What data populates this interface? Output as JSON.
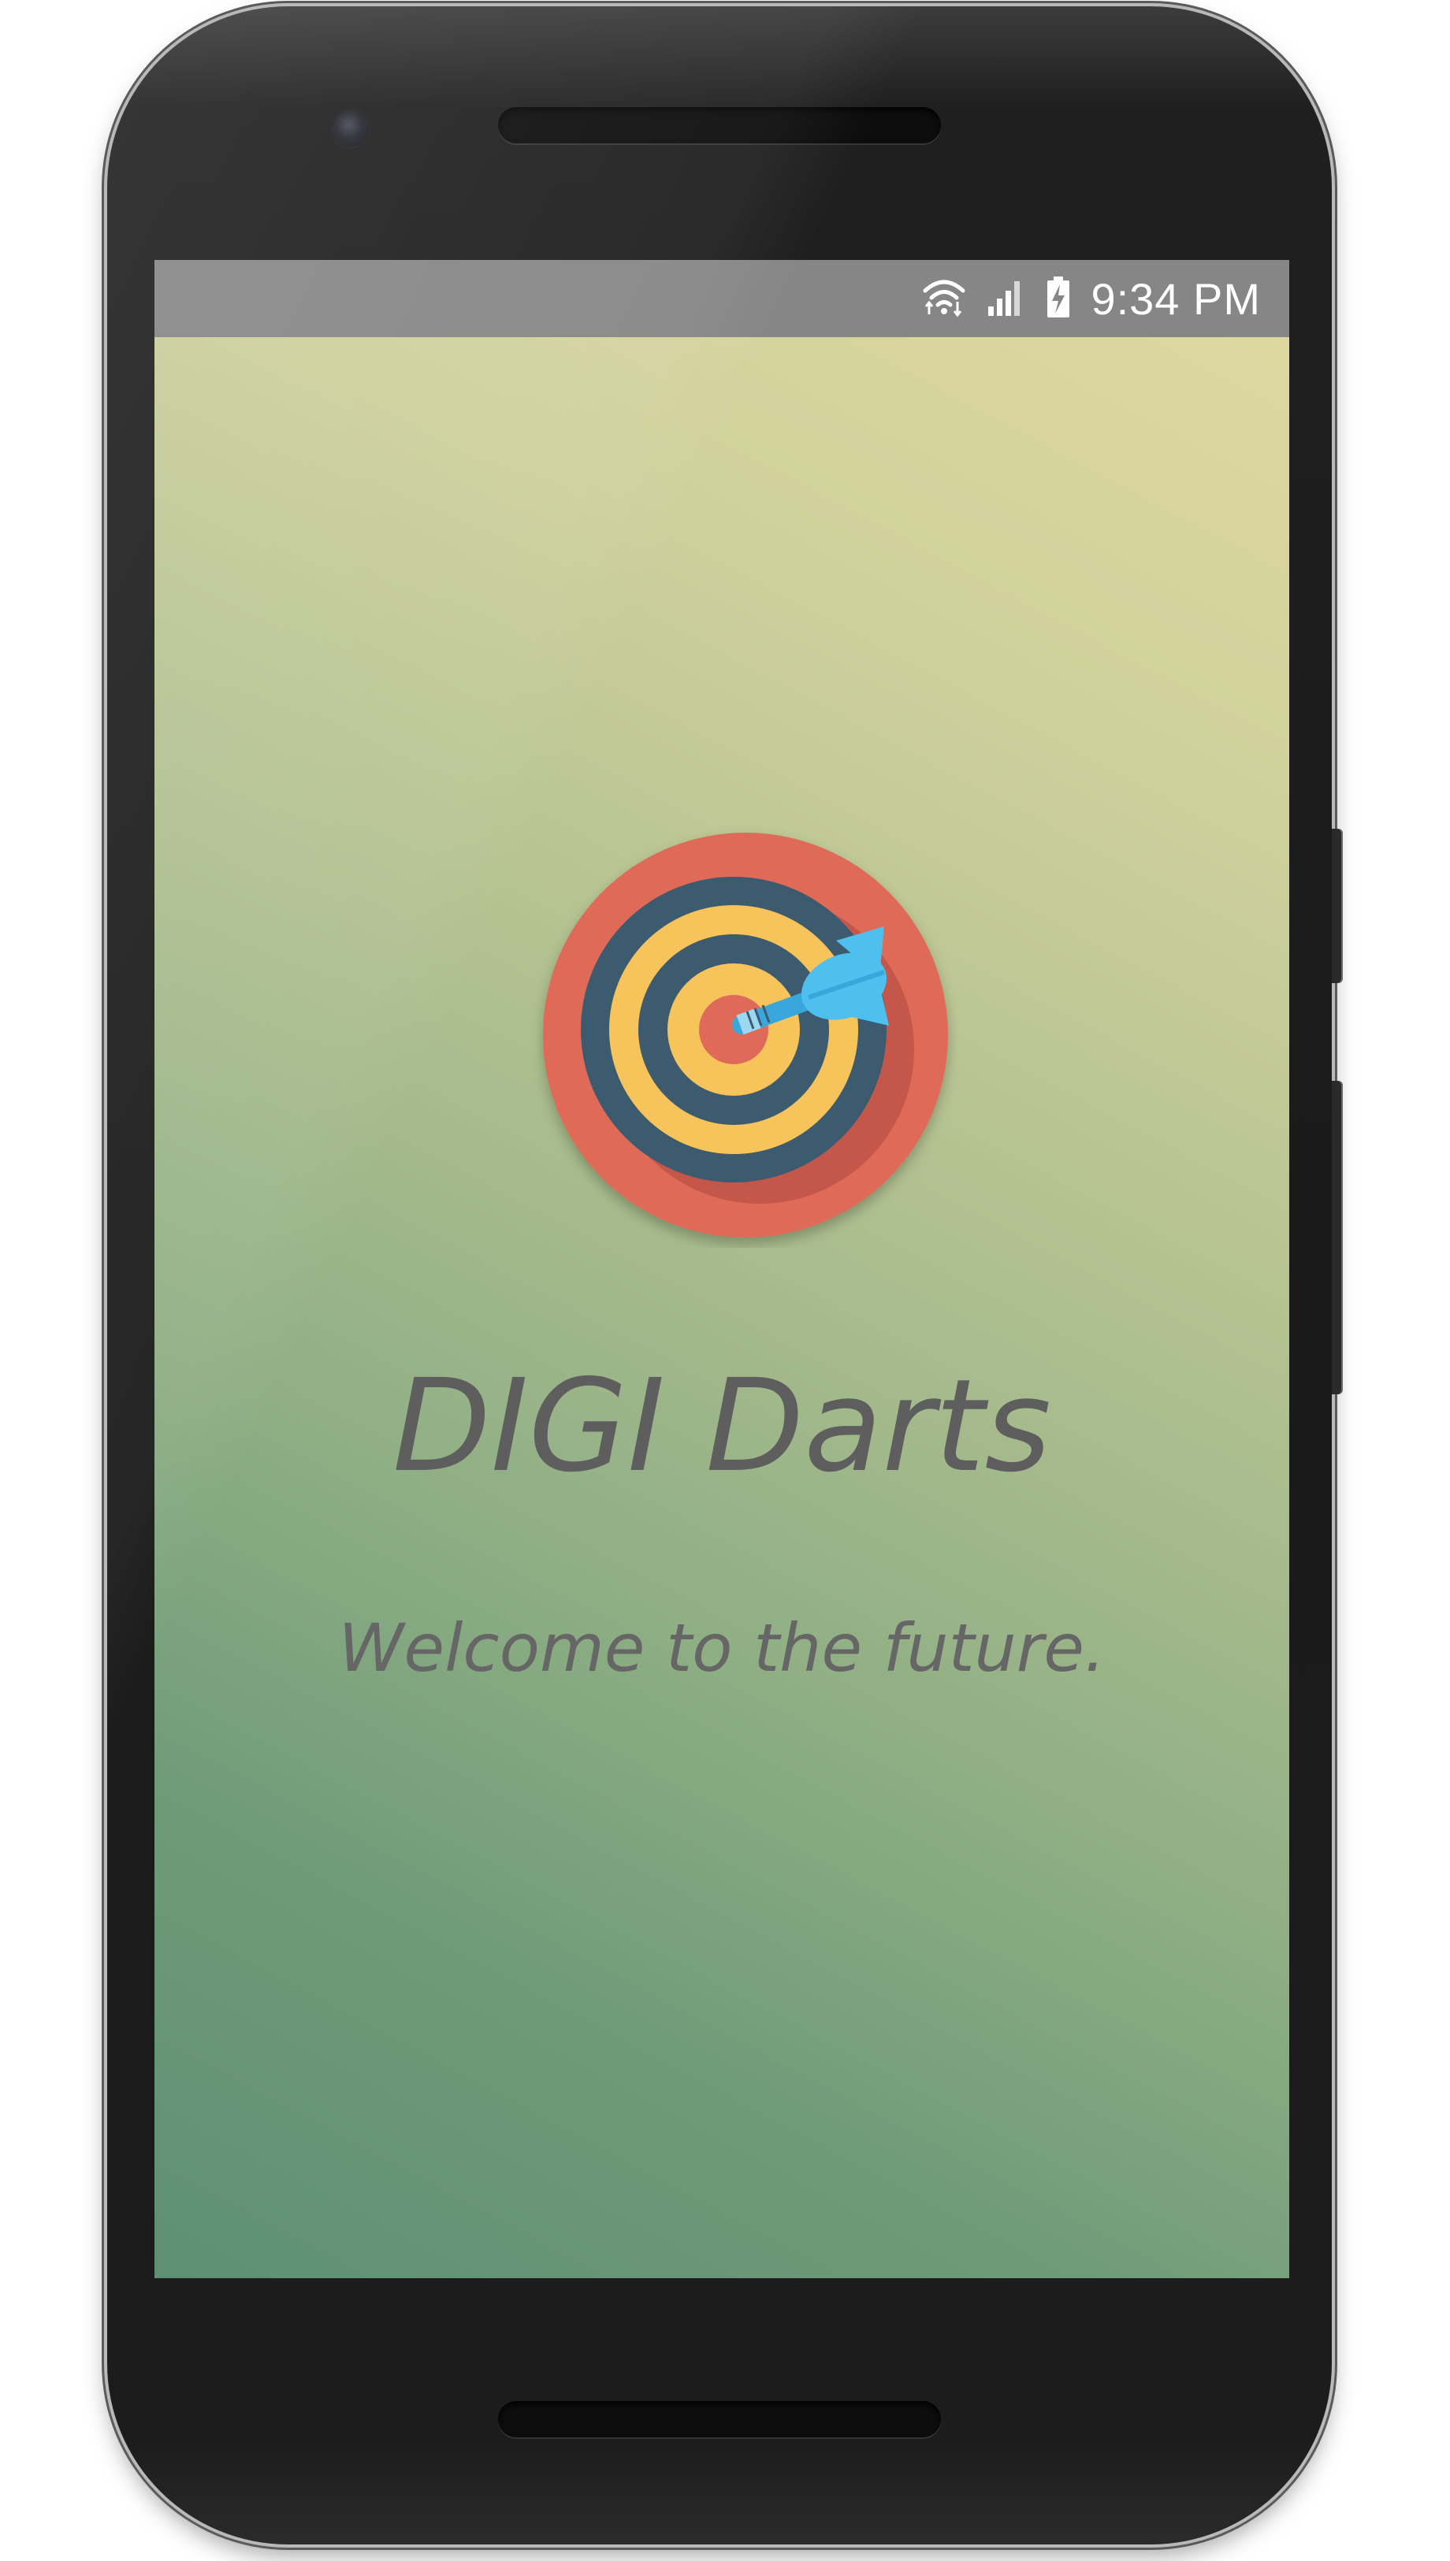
{
  "status_bar": {
    "time": "9:34 PM",
    "icons": [
      "wifi-icon",
      "signal-icon",
      "battery-charging-icon"
    ]
  },
  "app": {
    "logo_icon": "dartboard-with-dart-icon",
    "title": "DIGI Darts",
    "tagline": "Welcome to the future."
  },
  "colors": {
    "gradient_top": "#e0d9a1",
    "gradient_bottom": "#5f9074",
    "logo_outer": "#e06a59",
    "logo_ring_dark": "#3d5b6e",
    "logo_ring_yellow": "#f7c35b",
    "dart_blue": "#4ebfef",
    "text": "#5e5e5e"
  }
}
